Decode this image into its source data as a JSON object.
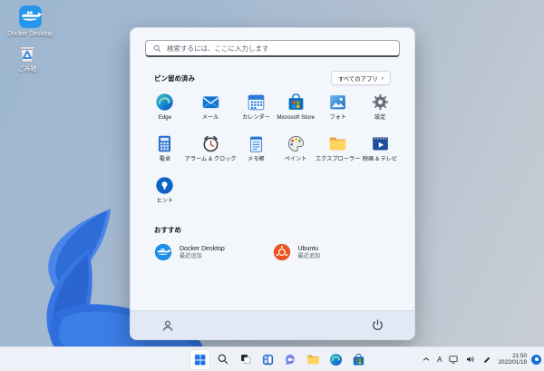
{
  "desktop": {
    "icons": [
      {
        "label": "Docker Desktop",
        "icon": "docker-whale-icon"
      },
      {
        "label": "ごみ箱",
        "icon": "recycle-bin-icon"
      }
    ]
  },
  "start_menu": {
    "search": {
      "placeholder": "検索するには、ここに入力します",
      "icon": "search-icon"
    },
    "pinned": {
      "title": "ピン留め済み",
      "all_apps": {
        "label": "すべてのアプリ",
        "chevron": "›"
      },
      "apps": [
        {
          "label": "Edge",
          "icon": "edge-icon"
        },
        {
          "label": "メール",
          "icon": "mail-icon"
        },
        {
          "label": "カレンダー",
          "icon": "calendar-icon"
        },
        {
          "label": "Microsoft Store",
          "icon": "store-icon"
        },
        {
          "label": "フォト",
          "icon": "photos-icon"
        },
        {
          "label": "設定",
          "icon": "settings-gear-icon"
        },
        {
          "label": "電卓",
          "icon": "calculator-icon"
        },
        {
          "label": "アラーム & クロック",
          "icon": "alarm-clock-icon"
        },
        {
          "label": "メモ帳",
          "icon": "notepad-icon"
        },
        {
          "label": "ペイント",
          "icon": "paint-palette-icon"
        },
        {
          "label": "エクスプローラー",
          "icon": "folder-icon"
        },
        {
          "label": "映画 & テレビ",
          "icon": "movies-tv-icon"
        },
        {
          "label": "ヒント",
          "icon": "tips-bulb-icon"
        }
      ]
    },
    "recommended": {
      "title": "おすすめ",
      "items": [
        {
          "name": "Docker Desktop",
          "status": "最近追加",
          "icon": "docker-whale-icon"
        },
        {
          "name": "Ubuntu",
          "status": "最近追加",
          "icon": "ubuntu-icon"
        }
      ]
    }
  },
  "taskbar": {
    "buttons": [
      "start",
      "search",
      "task-view",
      "widgets",
      "chat",
      "file-explorer",
      "edge",
      "store"
    ],
    "tray": {
      "hidden_icons": "chevron-up-icon",
      "ime_mode": "A",
      "icons": [
        "network-icon",
        "volume-icon",
        "pen-icon"
      ],
      "time": "21:50",
      "date": "2022/01/19",
      "notification": "notification-badge"
    }
  },
  "colors": {
    "accent_blue": "#1271d6",
    "menu_bg": "#f3f6fb",
    "taskbar_bg": "#eef2f8",
    "docker_blue": "#2496ed",
    "ubuntu_orange": "#e95420",
    "bloom_blue": "#2f6fdd"
  }
}
